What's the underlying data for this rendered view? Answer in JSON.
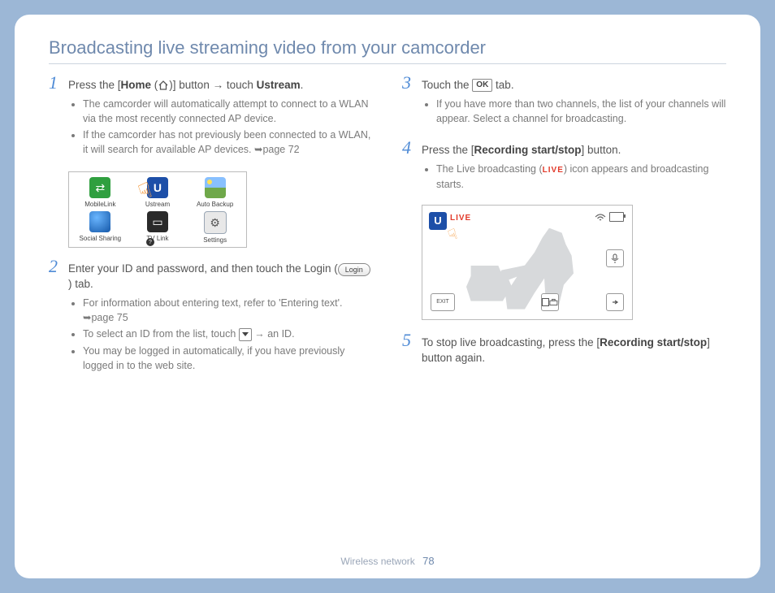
{
  "title": "Broadcasting live streaming video from your camcorder",
  "footer": {
    "section": "Wireless network",
    "page": "78"
  },
  "left": {
    "step1": {
      "num": "1",
      "lead_a": "Press the [",
      "lead_b_bold": "Home",
      "lead_c": " (",
      "lead_d": ")] button → touch ",
      "lead_e_bold": "Ustream",
      "lead_f": ".",
      "bullet1": "The camcorder will automatically attempt to connect to a WLAN via the most recently connected AP device.",
      "bullet2": "If the camcorder has not previously been connected to a WLAN, it will search for available AP devices. ➥page 72",
      "apps": {
        "a1": "MobileLink",
        "a2": "Ustream",
        "a3": "Auto Backup",
        "a4": "Social Sharing",
        "a5": "TV Link",
        "a6": "Settings"
      }
    },
    "step2": {
      "num": "2",
      "lead_a": "Enter your ID and password, and then touch the Login (",
      "login_label": "Login",
      "lead_b": ") tab.",
      "bullet1": "For information about entering text, refer to 'Entering text'. ➥page 75",
      "bullet2a": "To select an ID from the list, touch ",
      "bullet2b": " → an ID.",
      "bullet3": "You may be logged in automatically, if you have previously logged in to the web site."
    }
  },
  "right": {
    "step3": {
      "num": "3",
      "lead_a": "Touch the ",
      "ok_label": "OK",
      "lead_b": " tab.",
      "bullet1": "If you have more than two channels, the list of your channels will appear. Select a channel for broadcasting."
    },
    "step4": {
      "num": "4",
      "lead_a": "Press the [",
      "lead_b_bold": "Recording start/stop",
      "lead_c": "] button.",
      "bullet1a": "The Live broadcasting (",
      "live_label": "LIVE",
      "bullet1b": ") icon appears and broadcasting starts.",
      "vf": {
        "u": "U",
        "live": "LIVE",
        "exit": "EXIT"
      }
    },
    "step5": {
      "num": "5",
      "lead_a": "To stop live broadcasting, press the [",
      "lead_b_bold": "Recording start/stop",
      "lead_c": "] button again."
    }
  }
}
